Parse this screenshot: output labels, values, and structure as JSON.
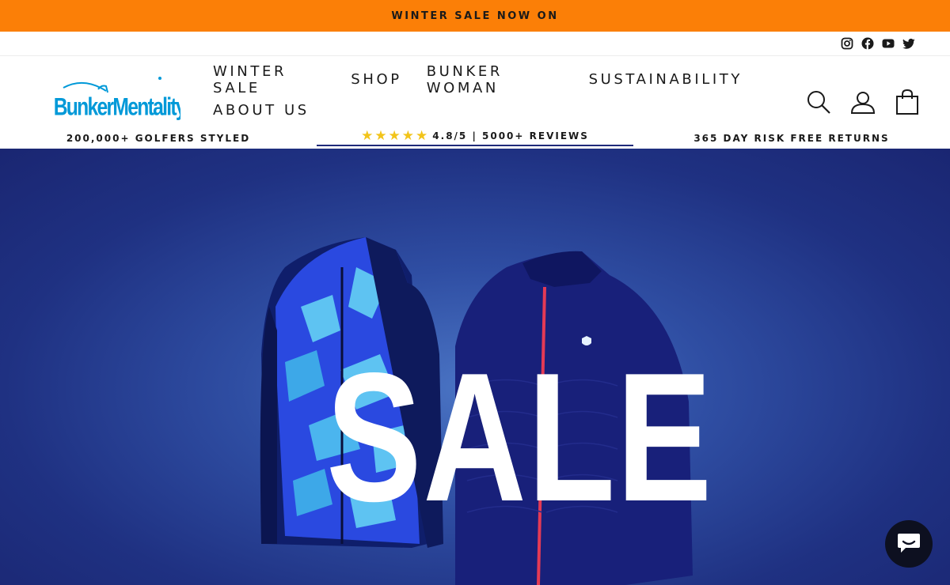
{
  "announcement": "WINTER SALE NOW ON",
  "social": {
    "items": [
      "instagram-icon",
      "facebook-icon",
      "youtube-icon",
      "twitter-icon"
    ]
  },
  "logo": {
    "alt": "BunkerMentality"
  },
  "nav": {
    "row1": [
      "WINTER SALE",
      "SHOP",
      "BUNKER WOMAN",
      "SUSTAINABILITY"
    ],
    "row2": [
      "ABOUT US"
    ]
  },
  "header_icons": [
    "search-icon",
    "account-icon",
    "cart-icon"
  ],
  "usp": {
    "left": "200,000+ GOLFERS STYLED",
    "mid_rating": "4.8/5 | 5000+ REVIEWS",
    "mid_stars": "★★★★★",
    "right": "365 DAY RISK FREE RETURNS"
  },
  "hero": {
    "headline": "SALE"
  },
  "colors": {
    "announce_bg": "#fb7f07",
    "hero_bg": "#2a43a0",
    "accent": "#0099d8"
  }
}
